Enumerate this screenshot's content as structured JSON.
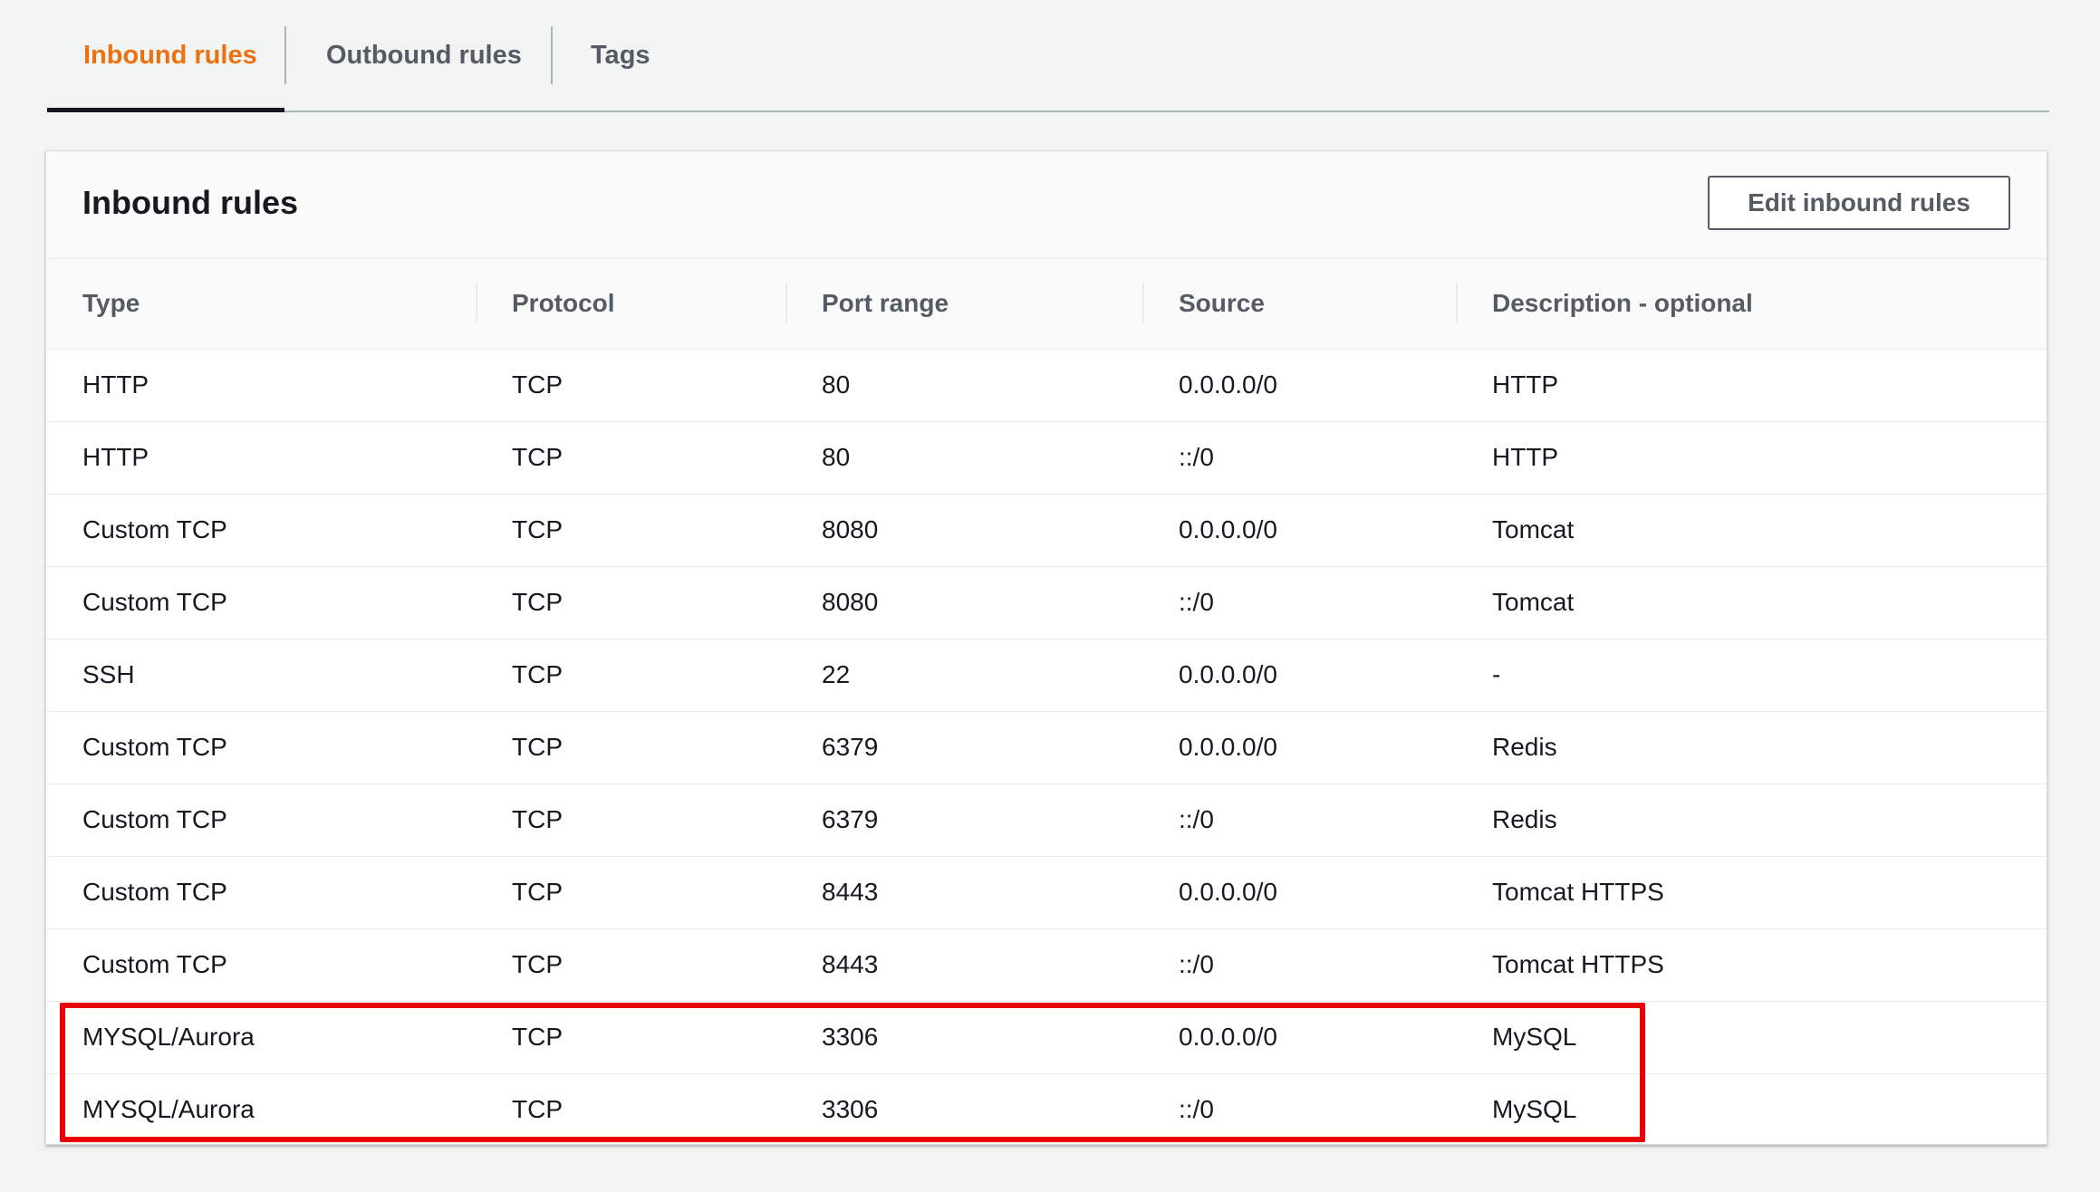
{
  "tabs": [
    {
      "label": "Inbound rules",
      "active": true
    },
    {
      "label": "Outbound rules",
      "active": false
    },
    {
      "label": "Tags",
      "active": false
    }
  ],
  "panel": {
    "title": "Inbound rules",
    "edit_button_label": "Edit inbound rules"
  },
  "table": {
    "headers": [
      "Type",
      "Protocol",
      "Port range",
      "Source",
      "Description - optional"
    ],
    "rows": [
      [
        "HTTP",
        "TCP",
        "80",
        "0.0.0.0/0",
        "HTTP"
      ],
      [
        "HTTP",
        "TCP",
        "80",
        "::/0",
        "HTTP"
      ],
      [
        "Custom TCP",
        "TCP",
        "8080",
        "0.0.0.0/0",
        "Tomcat"
      ],
      [
        "Custom TCP",
        "TCP",
        "8080",
        "::/0",
        "Tomcat"
      ],
      [
        "SSH",
        "TCP",
        "22",
        "0.0.0.0/0",
        "-"
      ],
      [
        "Custom TCP",
        "TCP",
        "6379",
        "0.0.0.0/0",
        "Redis"
      ],
      [
        "Custom TCP",
        "TCP",
        "6379",
        "::/0",
        "Redis"
      ],
      [
        "Custom TCP",
        "TCP",
        "8443",
        "0.0.0.0/0",
        "Tomcat HTTPS"
      ],
      [
        "Custom TCP",
        "TCP",
        "8443",
        "::/0",
        "Tomcat HTTPS"
      ],
      [
        "MYSQL/Aurora",
        "TCP",
        "3306",
        "0.0.0.0/0",
        "MySQL"
      ],
      [
        "MYSQL/Aurora",
        "TCP",
        "3306",
        "::/0",
        "MySQL"
      ]
    ],
    "highlighted_rows": [
      9,
      10
    ]
  },
  "colors": {
    "active_tab": "#ec7211",
    "highlight_box": "#e8000b",
    "background": "#f2f3f3"
  }
}
